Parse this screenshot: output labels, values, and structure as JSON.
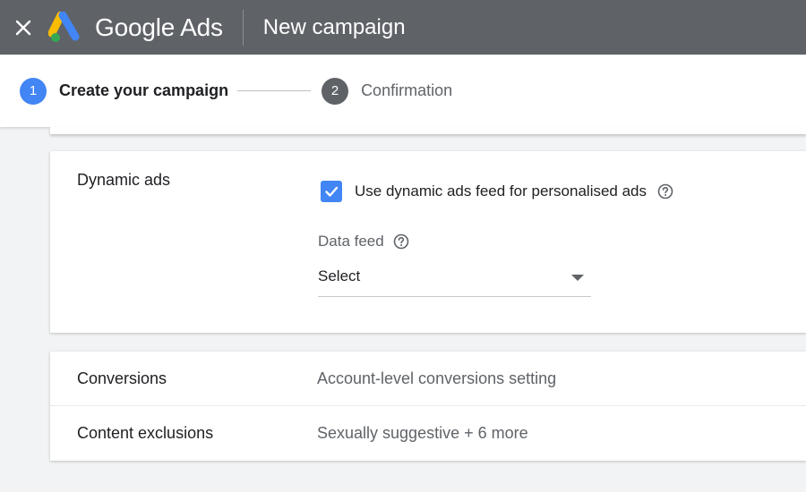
{
  "header": {
    "brand_google": "Google",
    "brand_ads": "Ads",
    "title": "New campaign",
    "close_icon": "close-icon",
    "logo_icon": "google-ads-logo"
  },
  "stepper": {
    "steps": [
      {
        "number": "1",
        "label": "Create your campaign",
        "state": "active"
      },
      {
        "number": "2",
        "label": "Confirmation",
        "state": "inactive"
      }
    ]
  },
  "dynamic_ads": {
    "title": "Dynamic ads",
    "checkbox_label": "Use dynamic ads feed for personalised ads",
    "checkbox_checked": true,
    "data_feed_label": "Data feed",
    "select_value": "Select"
  },
  "summary": {
    "rows": [
      {
        "key": "Conversions",
        "value": "Account-level conversions setting"
      },
      {
        "key": "Content exclusions",
        "value": "Sexually suggestive + 6 more"
      }
    ]
  },
  "colors": {
    "topbar": "#5f6368",
    "accent_blue": "#4285f4",
    "step_inactive": "#5f6368",
    "background": "#f1f3f4"
  }
}
